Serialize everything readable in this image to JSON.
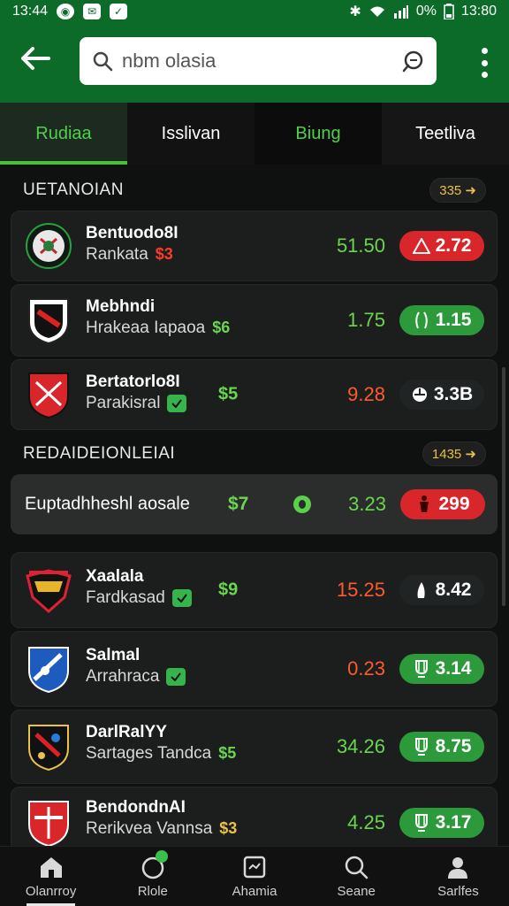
{
  "status": {
    "time": "13:44",
    "battery": "0%",
    "clock": "13:80"
  },
  "search": {
    "value": "nbm olasia"
  },
  "tabs": [
    "Rudiaa",
    "Isslivan",
    "Biung",
    "Teetliva"
  ],
  "sections": [
    {
      "title": "UETANOIAN",
      "badge": "335 ➜"
    },
    {
      "title": "REDAIDEIONLEIAI",
      "badge": "1435 ➜"
    }
  ],
  "matches": [
    {
      "name": "Bentuodo8I",
      "sub": "Rankata",
      "tag": "$3",
      "tag_color": "#ff3a2e",
      "mid": "",
      "odds": "51.50",
      "odds_color": "#6ad64e",
      "pill": "2.72",
      "pill_style": "red",
      "logo": "green-crest-icon"
    },
    {
      "name": "Mebhndi",
      "sub": "Hrakeaa Iapaoa",
      "tag": "$6",
      "tag_color": "#6ad64e",
      "mid": "",
      "odds": "1.75",
      "odds_color": "#6ad64e",
      "pill": "1.15",
      "pill_style": "green",
      "logo": "black-red-shield-icon"
    },
    {
      "name": "Bertatorlo8I",
      "sub": "Parakisral",
      "tag": "",
      "tag_color": "",
      "mid": "$5",
      "odds": "9.28",
      "odds_color": "#ff5a2c",
      "pill": "3.3B",
      "pill_style": "dark",
      "logo": "red-sword-shield-icon"
    }
  ],
  "feature": {
    "title": "Euptadhheshl aosale",
    "value": "$7",
    "odds": "3.23",
    "pill": "299"
  },
  "matches2": [
    {
      "name": "Xaalala",
      "sub": "Fardkasad",
      "mid": "$9",
      "odds": "15.25",
      "odds_color": "#ff5a2c",
      "pill": "8.42",
      "pill_style": "dark",
      "logo": "red-yellow-crest-icon"
    },
    {
      "name": "Salmal",
      "sub": "Arrahraca",
      "mid": "",
      "odds": "0.23",
      "odds_color": "#ff5a2c",
      "pill": "3.14",
      "pill_style": "green",
      "logo": "blue-shield-icon"
    },
    {
      "name": "DarlRalYY",
      "sub": "Sartages Tandca",
      "mid": "$5",
      "odds": "34.26",
      "odds_color": "#6ad64e",
      "pill": "8.75",
      "pill_style": "green",
      "logo": "black-colorful-shield-icon"
    },
    {
      "name": "BendondnAI",
      "sub": "Rerikvea Vannsa",
      "mid": "$3",
      "odds": "4.25",
      "odds_color": "#6ad64e",
      "pill": "3.17",
      "pill_style": "green",
      "logo": "red-emblem-shield-icon"
    }
  ],
  "nav": [
    "Olanrroy",
    "Rlole",
    "Ahamia",
    "Seane",
    "Sarlfes"
  ]
}
